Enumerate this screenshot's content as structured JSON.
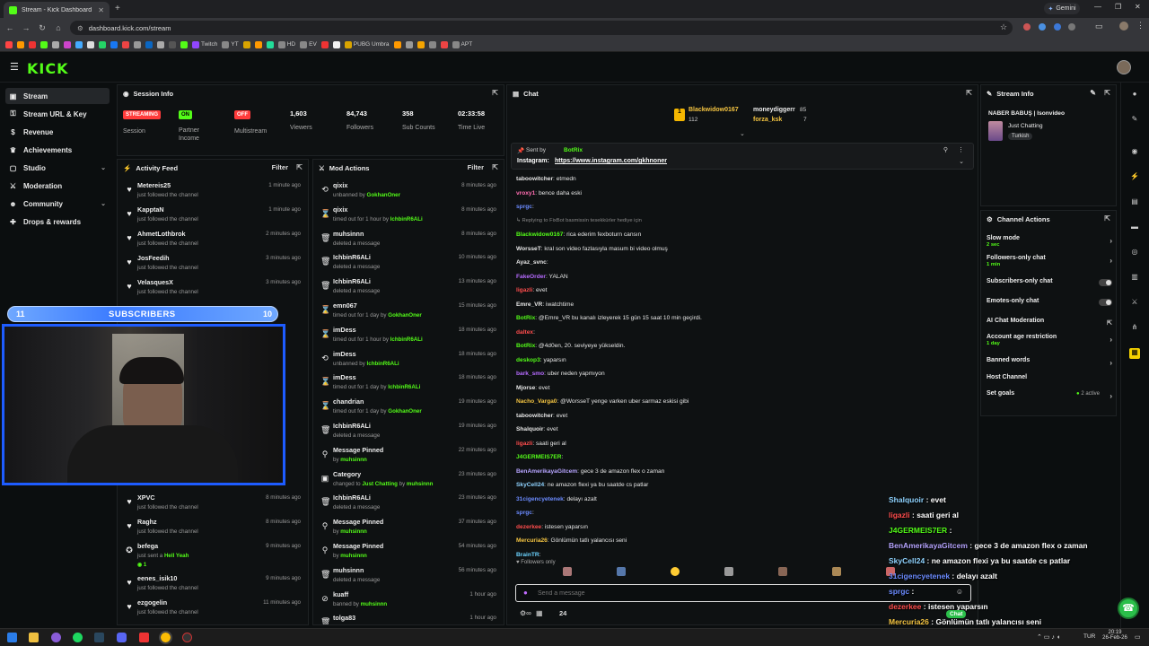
{
  "browser": {
    "tab_title": "Stream - Kick Dashboard",
    "url": "dashboard.kick.com/stream",
    "gemini_label": "Gemini",
    "bookmarks": [
      "Twitch",
      "YT",
      "HD",
      "EV",
      "PUBG Umbra",
      "APT"
    ]
  },
  "sidebar": {
    "items": [
      {
        "label": "Stream",
        "icon": "video-icon"
      },
      {
        "label": "Stream URL & Key",
        "icon": "key-icon"
      },
      {
        "label": "Revenue",
        "icon": "dollar-icon"
      },
      {
        "label": "Achievements",
        "icon": "trophy-icon"
      },
      {
        "label": "Studio",
        "icon": "studio-icon"
      },
      {
        "label": "Moderation",
        "icon": "sword-icon"
      },
      {
        "label": "Community",
        "icon": "users-icon"
      },
      {
        "label": "Drops & rewards",
        "icon": "gift-icon"
      }
    ]
  },
  "session": {
    "title": "Session Info",
    "streaming_badge": "STREAMING",
    "streaming_label": "Session",
    "partner_badge": "ON",
    "partner_label": "Partner Income",
    "multistream_badge": "OFF",
    "multistream_label": "Multistream",
    "viewers": "1,603",
    "viewers_label": "Viewers",
    "followers": "84,743",
    "followers_label": "Followers",
    "subs": "358",
    "subs_label": "Sub Counts",
    "time": "02:33:58",
    "time_label": "Time Live"
  },
  "activity": {
    "title": "Activity Feed",
    "filter": "Filter",
    "rows": [
      {
        "name": "Metereis25",
        "sub": "just followed the channel",
        "time": "1 minute ago"
      },
      {
        "name": "KapptaN",
        "sub": "just followed the channel",
        "time": "1 minute ago"
      },
      {
        "name": "AhmetLothbrok",
        "sub": "just followed the channel",
        "time": "2 minutes ago"
      },
      {
        "name": "JosFeedih",
        "sub": "just followed the channel",
        "time": "3 minutes ago"
      },
      {
        "name": "VelasquesX",
        "sub": "just followed the channel",
        "time": "3 minutes ago"
      },
      {
        "name": "XPVC",
        "sub": "just followed the channel",
        "time": "8 minutes ago"
      },
      {
        "name": "Raghz",
        "sub": "just followed the channel",
        "time": "8 minutes ago"
      },
      {
        "name": "befega",
        "sub": "just sent a",
        "hl": "Hell Yeah",
        "extra": "1",
        "time": "9 minutes ago"
      },
      {
        "name": "eenes_isik10",
        "sub": "just followed the channel",
        "time": "9 minutes ago"
      },
      {
        "name": "ezgogelin",
        "sub": "just followed the channel",
        "time": "11 minutes ago"
      }
    ]
  },
  "mod": {
    "title": "Mod Actions",
    "filter": "Filter",
    "rows": [
      {
        "name": "qixix",
        "sub": "unbanned by",
        "hl": "GokhanOner",
        "time": "8 minutes ago",
        "icon": "undo"
      },
      {
        "name": "qixix",
        "sub": "timed out for 1 hour by",
        "hl": "IchbinR6ALi",
        "time": "8 minutes ago",
        "icon": "hourglass"
      },
      {
        "name": "muhsinnn",
        "sub": "deleted a message",
        "hl": "",
        "time": "8 minutes ago",
        "icon": "trash"
      },
      {
        "name": "IchbinR6ALi",
        "sub": "deleted a message",
        "hl": "",
        "time": "10 minutes ago",
        "icon": "trash"
      },
      {
        "name": "IchbinR6ALi",
        "sub": "deleted a message",
        "hl": "",
        "time": "13 minutes ago",
        "icon": "trash"
      },
      {
        "name": "emn067",
        "sub": "timed out for 1 day by",
        "hl": "GokhanOner",
        "time": "15 minutes ago",
        "icon": "hourglass"
      },
      {
        "name": "imDess",
        "sub": "timed out for 1 hour by",
        "hl": "IchbinR6ALi",
        "time": "18 minutes ago",
        "icon": "hourglass"
      },
      {
        "name": "imDess",
        "sub": "unbanned by",
        "hl": "IchbinR6ALi",
        "time": "18 minutes ago",
        "icon": "undo"
      },
      {
        "name": "imDess",
        "sub": "timed out for 1 day by",
        "hl": "IchbinR6ALi",
        "time": "18 minutes ago",
        "icon": "hourglass"
      },
      {
        "name": "chandrian",
        "sub": "timed out for 1 day by",
        "hl": "GokhanOner",
        "time": "19 minutes ago",
        "icon": "hourglass"
      },
      {
        "name": "IchbinR6ALi",
        "sub": "deleted a message",
        "hl": "",
        "time": "19 minutes ago",
        "icon": "trash"
      },
      {
        "name": "Message Pinned",
        "sub": "by",
        "hl": "muhsinnn",
        "time": "22 minutes ago",
        "icon": "pin"
      },
      {
        "name": "Category",
        "sub": "changed to",
        "hl": "Just Chatting",
        "sub2": "by",
        "hl2": "muhsinnn",
        "time": "23 minutes ago",
        "icon": "category"
      },
      {
        "name": "IchbinR6ALi",
        "sub": "deleted a message",
        "hl": "",
        "time": "23 minutes ago",
        "icon": "trash"
      },
      {
        "name": "Message Pinned",
        "sub": "by",
        "hl": "muhsinnn",
        "time": "37 minutes ago",
        "icon": "pin"
      },
      {
        "name": "Message Pinned",
        "sub": "by",
        "hl": "muhsinnn",
        "time": "54 minutes ago",
        "icon": "pin"
      },
      {
        "name": "muhsinnn",
        "sub": "deleted a message",
        "hl": "",
        "time": "56 minutes ago",
        "icon": "trash"
      },
      {
        "name": "kuaff",
        "sub": "banned by",
        "hl": "muhsinnn",
        "time": "1 hour ago",
        "icon": "ban"
      },
      {
        "name": "tolga83",
        "sub": "",
        "hl": "",
        "time": "1 hour ago",
        "icon": "trash"
      }
    ]
  },
  "chat": {
    "title": "Chat",
    "top_gifter": "Blackwidow0167",
    "top_gifter_count": "112",
    "gifter2": "moneydiggerr",
    "gifter2_count": "85",
    "gifter3": "forza_ksk",
    "gifter3_count": "7",
    "pinned_by_label": "Sent by",
    "pinned_by": "BotRix",
    "pinned_text": "Instagram:",
    "pinned_link": "https://www.instagram.com/gkhnoner",
    "lines": [
      {
        "u": "taboowitcher",
        "c": "#e6e6e6",
        "t": "etmedn"
      },
      {
        "u": "vroxy1",
        "c": "#ff6db1",
        "t": "bence daha eski"
      },
      {
        "u": "sprgc",
        "c": "#6b8bff",
        "t": ""
      },
      {
        "u": "Replying to FixBot",
        "c": "#888",
        "t": "basmissin tesekkürler hediye için"
      },
      {
        "u": "Blackwidow0167",
        "c": "#53fc18",
        "t": "rica ederim fexboturn cansın"
      },
      {
        "u": "WorsseT",
        "c": "#e6e6e6",
        "t": "kral son video fazlasıyla masum bi video olmuş"
      },
      {
        "u": "Ayaz_svnc",
        "c": "#e6e6e6",
        "t": ""
      },
      {
        "u": "FakeOrder",
        "c": "#b66bff",
        "t": "YALAN"
      },
      {
        "u": "ligazli",
        "c": "#ff4d4d",
        "t": "evet"
      },
      {
        "u": "Emre_VR",
        "c": "#e6e6e6",
        "t": "iwatchtime"
      },
      {
        "u": "BotRix",
        "c": "#53fc18",
        "t": "@Emre_VR bu kanalı izleyerek 15 gün 15 saat 10 min geçirdi."
      },
      {
        "u": "daltex",
        "c": "#ff4d4d",
        "t": ""
      },
      {
        "u": "BotRix",
        "c": "#53fc18",
        "t": "@4d0en, 20. seviyeye yükseldin."
      },
      {
        "u": "deskop3",
        "c": "#53fc18",
        "t": "yaparsın"
      },
      {
        "u": "bark_smo",
        "c": "#b66bff",
        "t": "uber neden yapmıyon"
      },
      {
        "u": "Mjorse",
        "c": "#e6e6e6",
        "t": "evet"
      },
      {
        "u": "Nacho_Varga0",
        "c": "#f5c542",
        "t": "@WorsseT yenge varken uber sarmaz eskisi gibi"
      },
      {
        "u": "taboowitcher",
        "c": "#e6e6e6",
        "t": "evet"
      },
      {
        "u": "Shalquoir",
        "c": "#e6e6e6",
        "t": "evet"
      },
      {
        "u": "ligazli",
        "c": "#ff4d4d",
        "t": "saati geri al"
      },
      {
        "u": "J4GERMEIS7ER",
        "c": "#53fc18",
        "t": ""
      },
      {
        "u": "BenAmerikayaGitcem",
        "c": "#b6a4ff",
        "t": "gece 3 de amazon flex o zaman"
      },
      {
        "u": "SkyCell24",
        "c": "#8fd3ff",
        "t": "ne amazon flexi ya bu saatde cs patlar"
      },
      {
        "u": "31cigencyetenek",
        "c": "#6b8bff",
        "t": "delayı azalt"
      },
      {
        "u": "sprgc",
        "c": "#6b8bff",
        "t": ""
      },
      {
        "u": "dezerkee",
        "c": "#ff4d4d",
        "t": "istesen yaparsın"
      },
      {
        "u": "Mercuria26",
        "c": "#f5c542",
        "t": "Gönlümün tatlı yalancısı seni"
      },
      {
        "u": "BrainTR",
        "c": "#6bd3ff",
        "t": ""
      }
    ],
    "followers_only": "Followers only",
    "input_placeholder": "Send a message",
    "viewer_count": "24"
  },
  "stream_info": {
    "title": "Stream Info",
    "stream_title": "NABER BABUŞ | Isonvideo",
    "category": "Just Chatting",
    "tag": "Turkish"
  },
  "channel_actions": {
    "title": "Channel Actions",
    "slow_mode": "Slow mode",
    "slow_mode_sub": "2 sec",
    "followers_only": "Followers-only chat",
    "followers_only_sub": "1 min",
    "subscribers_only": "Subscribers-only chat",
    "emotes_only": "Emotes-only chat",
    "ai_mod": "AI Chat Moderation",
    "account_age": "Account age restriction",
    "account_age_sub": "1 day",
    "banned_words": "Banned words",
    "host": "Host Channel",
    "goals": "Set goals",
    "goals_sub": "2 active"
  },
  "overlay": {
    "subs_left": "11",
    "subs_label": "SUBSCRIBERS",
    "subs_right": "10",
    "lines": [
      {
        "u": "Shalquoir",
        "c": "#8fd3ff",
        "t": ": evet"
      },
      {
        "u": "ligazli",
        "c": "#ff4d4d",
        "t": ": saati geri al"
      },
      {
        "u": "J4GERMEIS7ER",
        "c": "#53fc18",
        "t": ":"
      },
      {
        "u": "BenAmerikayaGitcem",
        "c": "#b6a4ff",
        "t": ": gece 3 de amazon flex o zaman"
      },
      {
        "u": "SkyCell24",
        "c": "#8fd3ff",
        "t": ": ne amazon flexi ya bu saatde cs patlar"
      },
      {
        "u": "31cigencyetenek",
        "c": "#6b8bff",
        "t": ": delayı azalt"
      },
      {
        "u": "sprgc",
        "c": "#6b8bff",
        "t": ":"
      },
      {
        "u": "dezerkee",
        "c": "#ff4d4d",
        "t": ": istesen yaparsın"
      },
      {
        "u": "Mercuria26",
        "c": "#f5c542",
        "t": ": Gönlümün tatlı yalancısı seni"
      }
    ],
    "chat_tag": "Chat"
  },
  "taskbar": {
    "lang": "TUR",
    "time": "20:19",
    "date": "26-Feb-26"
  },
  "colors": {
    "accent": "#53fc18",
    "danger": "#ff3b3b",
    "bg": "#0b0e0f"
  }
}
